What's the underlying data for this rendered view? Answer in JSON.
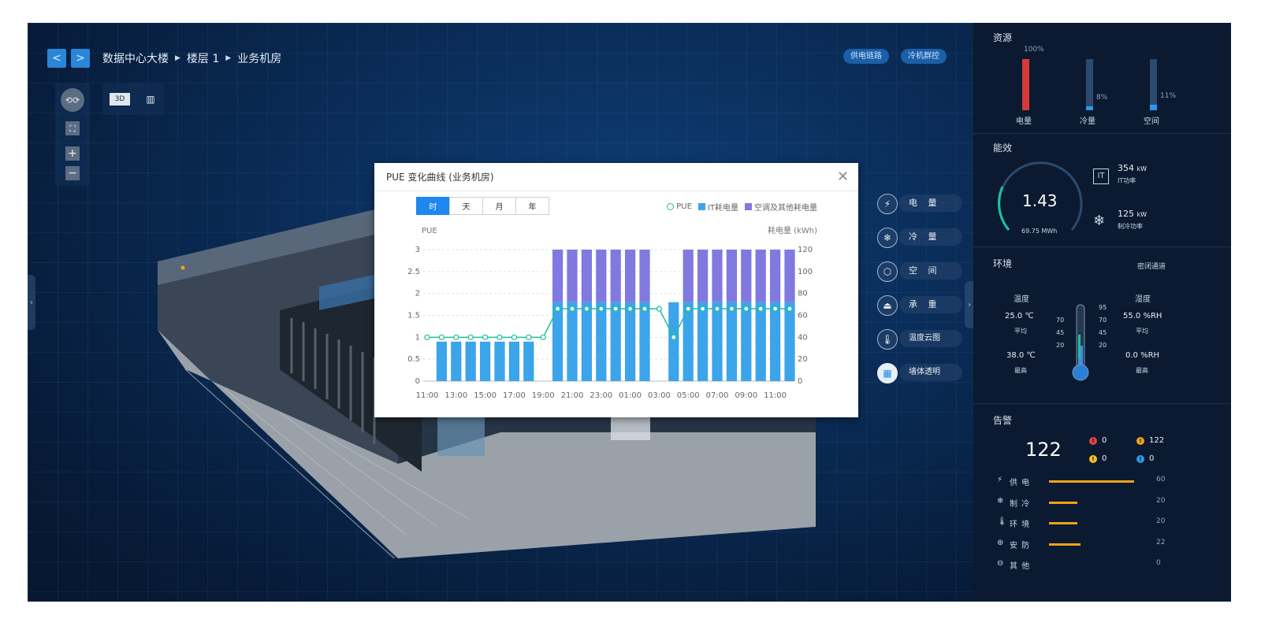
{
  "breadcrumb": [
    "数据中心大楼",
    "楼层 1",
    "业务机房"
  ],
  "nav": {
    "prev": "<",
    "next": ">"
  },
  "top_pills": [
    "供电链路",
    "冷机群控"
  ],
  "view_tools": {
    "d3": "3D"
  },
  "modal": {
    "title": "PUE 变化曲线 (业务机房)",
    "tabs": [
      "时",
      "天",
      "月",
      "年"
    ],
    "active_tab": "时",
    "legend": [
      "PUE",
      "IT耗电量",
      "空调及其他耗电量"
    ]
  },
  "chart_data": {
    "type": "bar",
    "ylabel": "PUE",
    "y2label": "耗电量 (kWh)",
    "ylim": [
      0,
      3
    ],
    "y2lim": [
      0,
      120
    ],
    "yticks": [
      "0",
      "0.5",
      "1",
      "1.5",
      "2",
      "2.5",
      "3"
    ],
    "y2ticks": [
      "0",
      "20",
      "40",
      "60",
      "80",
      "100",
      "120"
    ],
    "xticks": [
      "11:00",
      "13:00",
      "15:00",
      "17:00",
      "19:00",
      "21:00",
      "23:00",
      "01:00",
      "03:00",
      "05:00",
      "07:00",
      "09:00",
      "11:00"
    ],
    "pue": [
      1,
      1,
      1,
      1,
      1,
      1,
      1,
      1,
      1,
      1.65,
      1.65,
      1.65,
      1.65,
      1.65,
      1.65,
      1.65,
      1.65,
      1,
      1.65,
      1.65,
      1.65,
      1.65,
      1.65,
      1.65,
      1.65,
      1.65
    ],
    "series": [
      {
        "name": "IT耗电量",
        "color": "#3ca4ea",
        "values": [
          0,
          36,
          36,
          36,
          36,
          36,
          36,
          36,
          0,
          72,
          72,
          72,
          72,
          72,
          72,
          72,
          0,
          72,
          72,
          72,
          72,
          72,
          72,
          72,
          72,
          72
        ]
      },
      {
        "name": "空调及其他耗电量",
        "color": "#8179e0",
        "values": [
          0,
          0,
          0,
          0,
          0,
          0,
          0,
          0,
          0,
          48,
          48,
          48,
          48,
          48,
          48,
          48,
          0,
          0,
          48,
          48,
          48,
          48,
          48,
          48,
          48,
          48
        ]
      }
    ],
    "pue_color": "#1cc19f"
  },
  "right_menu": [
    {
      "label": "电 量",
      "icon": "⚡"
    },
    {
      "label": "冷 量",
      "icon": "❄"
    },
    {
      "label": "空 间",
      "icon": "⬡"
    },
    {
      "label": "承 重",
      "icon": "⏏"
    },
    {
      "label": "温度云图",
      "icon": "🌡"
    },
    {
      "label": "墙体透明",
      "icon": "▦"
    }
  ],
  "resources": {
    "title": "资源",
    "bars": [
      {
        "label": "电量",
        "pct": "100%",
        "value": 1.0,
        "color": "#d83a3a"
      },
      {
        "label": "冷量",
        "pct": "8%",
        "value": 0.08,
        "color": "#2a9ae8"
      },
      {
        "label": "空间",
        "pct": "11%",
        "value": 0.11,
        "color": "#2a9ae8"
      }
    ]
  },
  "efficiency": {
    "title": "能效",
    "pue": "1.43",
    "mwh": "69.75 MWh",
    "it_power": "354",
    "it_unit": "kW",
    "it_label": "IT功率",
    "it_icon": "IT",
    "cool_power": "125",
    "cool_unit": "kW",
    "cool_label": "制冷功率"
  },
  "environment": {
    "title": "环境",
    "link": "密闭通道",
    "temp_label": "温度",
    "hum_label": "湿度",
    "temp_avg": "25.0 ℃",
    "temp_max": "38.0 ℃",
    "hum_avg": "55.0 %RH",
    "hum_max": "0.0 %RH",
    "avg": "平均",
    "max": "最高",
    "left_scale": [
      "70",
      "45",
      "20"
    ],
    "right_scale": [
      "95",
      "70",
      "45",
      "20"
    ],
    "thermo_level": 0.35
  },
  "alarm": {
    "title": "告警",
    "total": "122",
    "counts": [
      {
        "value": "0",
        "color": "#e0433a"
      },
      {
        "value": "122",
        "color": "#f0a317"
      },
      {
        "value": "0",
        "color": "#f5c21b"
      },
      {
        "value": "0",
        "color": "#2a9ae8"
      }
    ],
    "categories": [
      {
        "label": "供 电",
        "icon": "⚡",
        "value": "60",
        "ratio": 1.0
      },
      {
        "label": "制 冷",
        "icon": "❄",
        "value": "20",
        "ratio": 0.33
      },
      {
        "label": "环 境",
        "icon": "🌡",
        "value": "20",
        "ratio": 0.33
      },
      {
        "label": "安 防",
        "icon": "⊕",
        "value": "22",
        "ratio": 0.37
      },
      {
        "label": "其 他",
        "icon": "⊖",
        "value": "0",
        "ratio": 0
      }
    ]
  }
}
